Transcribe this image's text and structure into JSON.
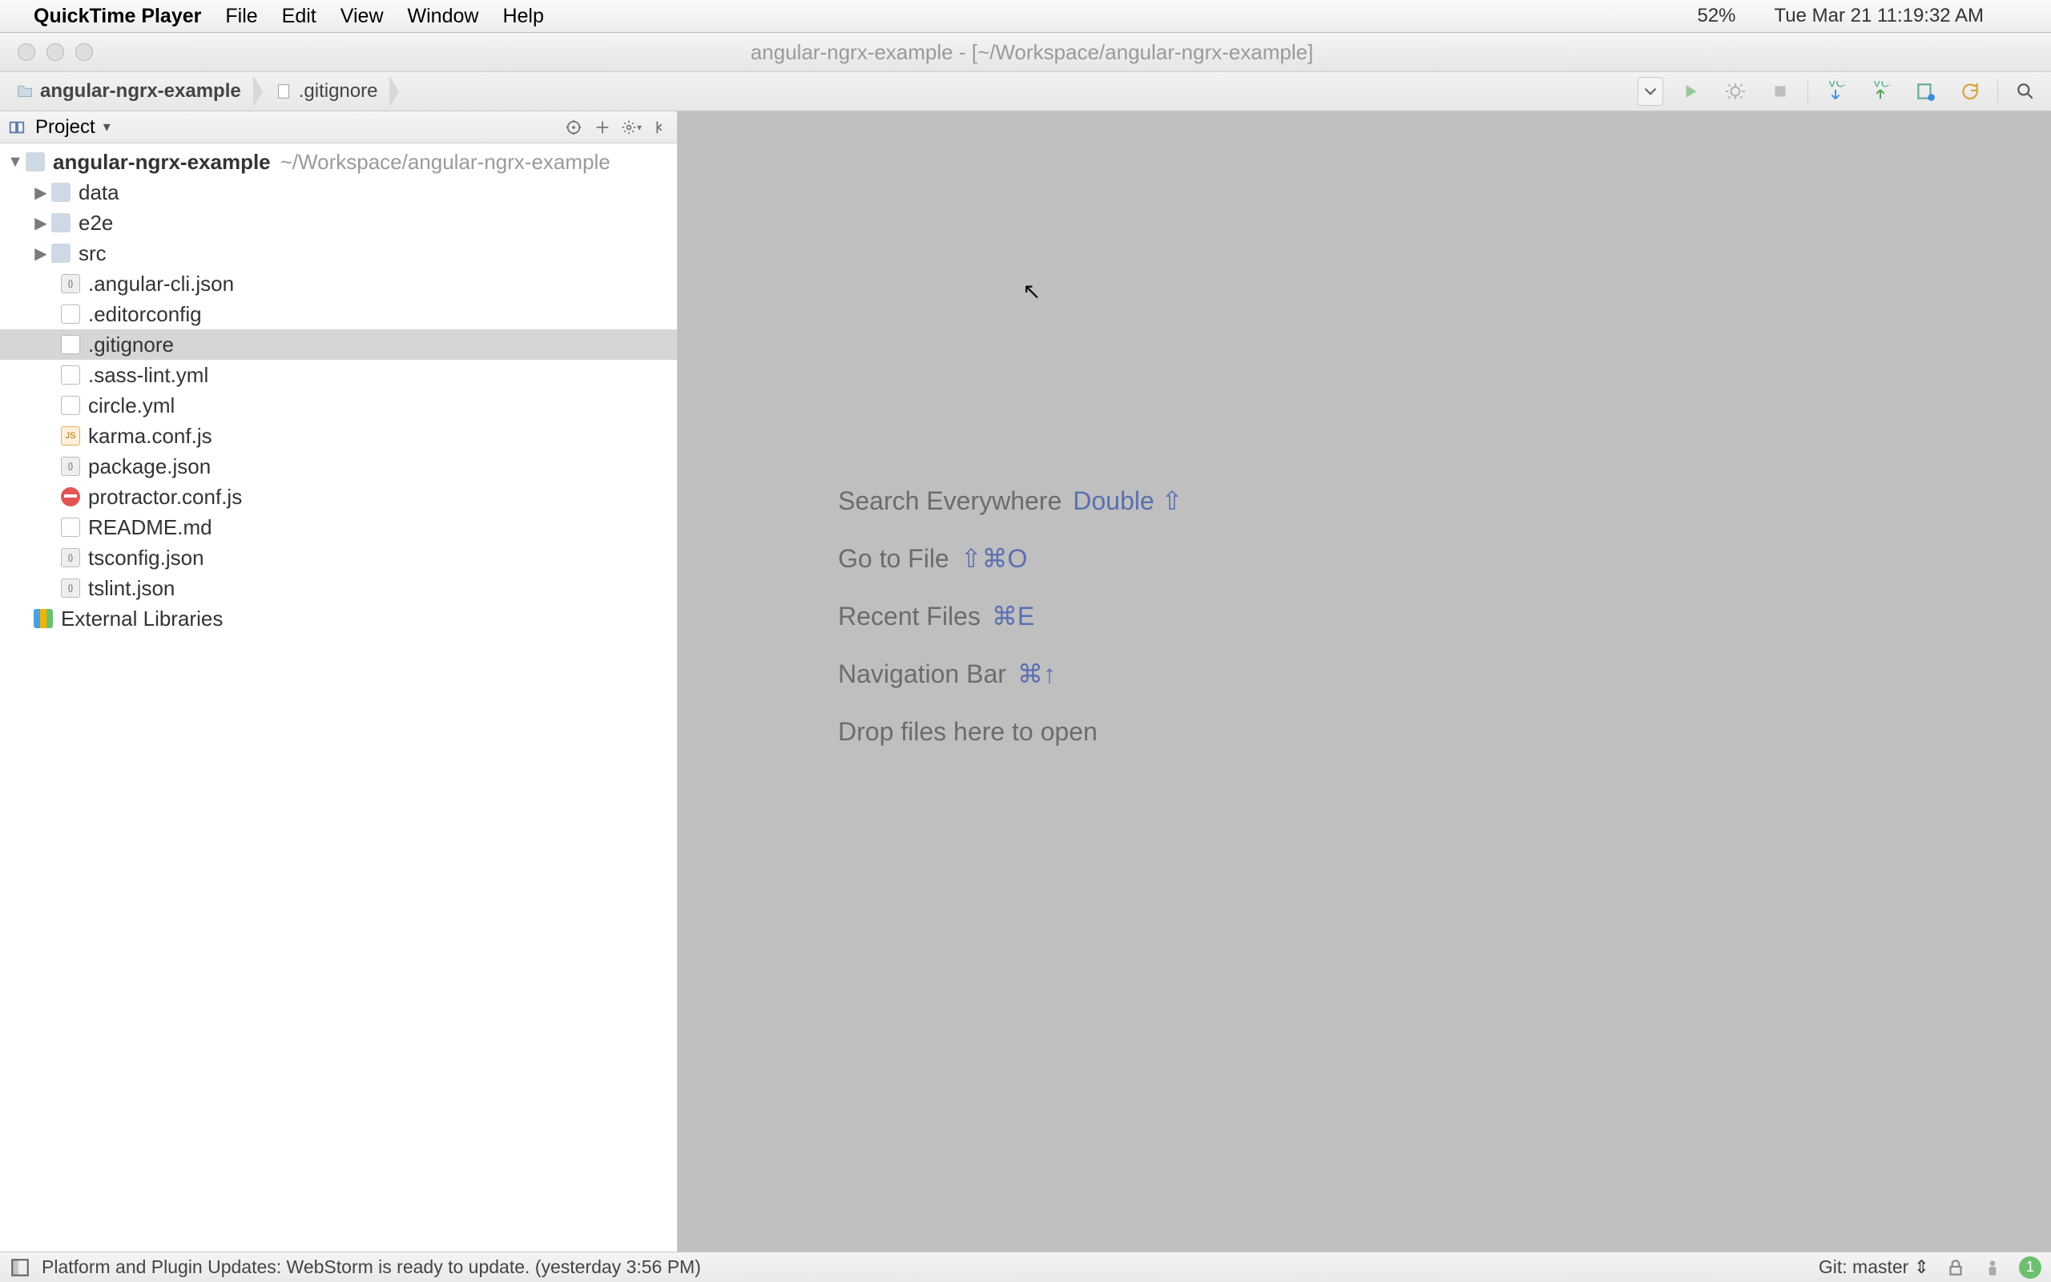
{
  "menubar": {
    "app": "QuickTime Player",
    "items": [
      "File",
      "Edit",
      "View",
      "Window",
      "Help"
    ],
    "battery": "52%",
    "datetime": "Tue Mar 21  11:19:32 AM"
  },
  "window": {
    "title": "angular-ngrx-example - [~/Workspace/angular-ngrx-example]"
  },
  "breadcrumb": {
    "root": "angular-ngrx-example",
    "file": ".gitignore"
  },
  "panel": {
    "title": "Project"
  },
  "tree": {
    "root_name": "angular-ngrx-example",
    "root_path": "~/Workspace/angular-ngrx-example",
    "folders": [
      "data",
      "e2e",
      "src"
    ],
    "files": [
      {
        "name": ".angular-cli.json",
        "icon": "json"
      },
      {
        "name": ".editorconfig",
        "icon": "text"
      },
      {
        "name": ".gitignore",
        "icon": "text",
        "selected": true
      },
      {
        "name": ".sass-lint.yml",
        "icon": "yml"
      },
      {
        "name": "circle.yml",
        "icon": "yml"
      },
      {
        "name": "karma.conf.js",
        "icon": "js"
      },
      {
        "name": "package.json",
        "icon": "json"
      },
      {
        "name": "protractor.conf.js",
        "icon": "stop"
      },
      {
        "name": "README.md",
        "icon": "text"
      },
      {
        "name": "tsconfig.json",
        "icon": "json"
      },
      {
        "name": "tslint.json",
        "icon": "json"
      }
    ],
    "ext_lib": "External Libraries"
  },
  "editor_hints": {
    "l1_label": "Search Everywhere",
    "l1_key": "Double ⇧",
    "l2_label": "Go to File",
    "l2_key": "⇧⌘O",
    "l3_label": "Recent Files",
    "l3_key": "⌘E",
    "l4_label": "Navigation Bar",
    "l4_key": "⌘↑",
    "l5_label": "Drop files here to open"
  },
  "statusbar": {
    "message": "Platform and Plugin Updates: WebStorm is ready to update. (yesterday 3:56 PM)",
    "git": "Git: master",
    "badge": "1"
  }
}
